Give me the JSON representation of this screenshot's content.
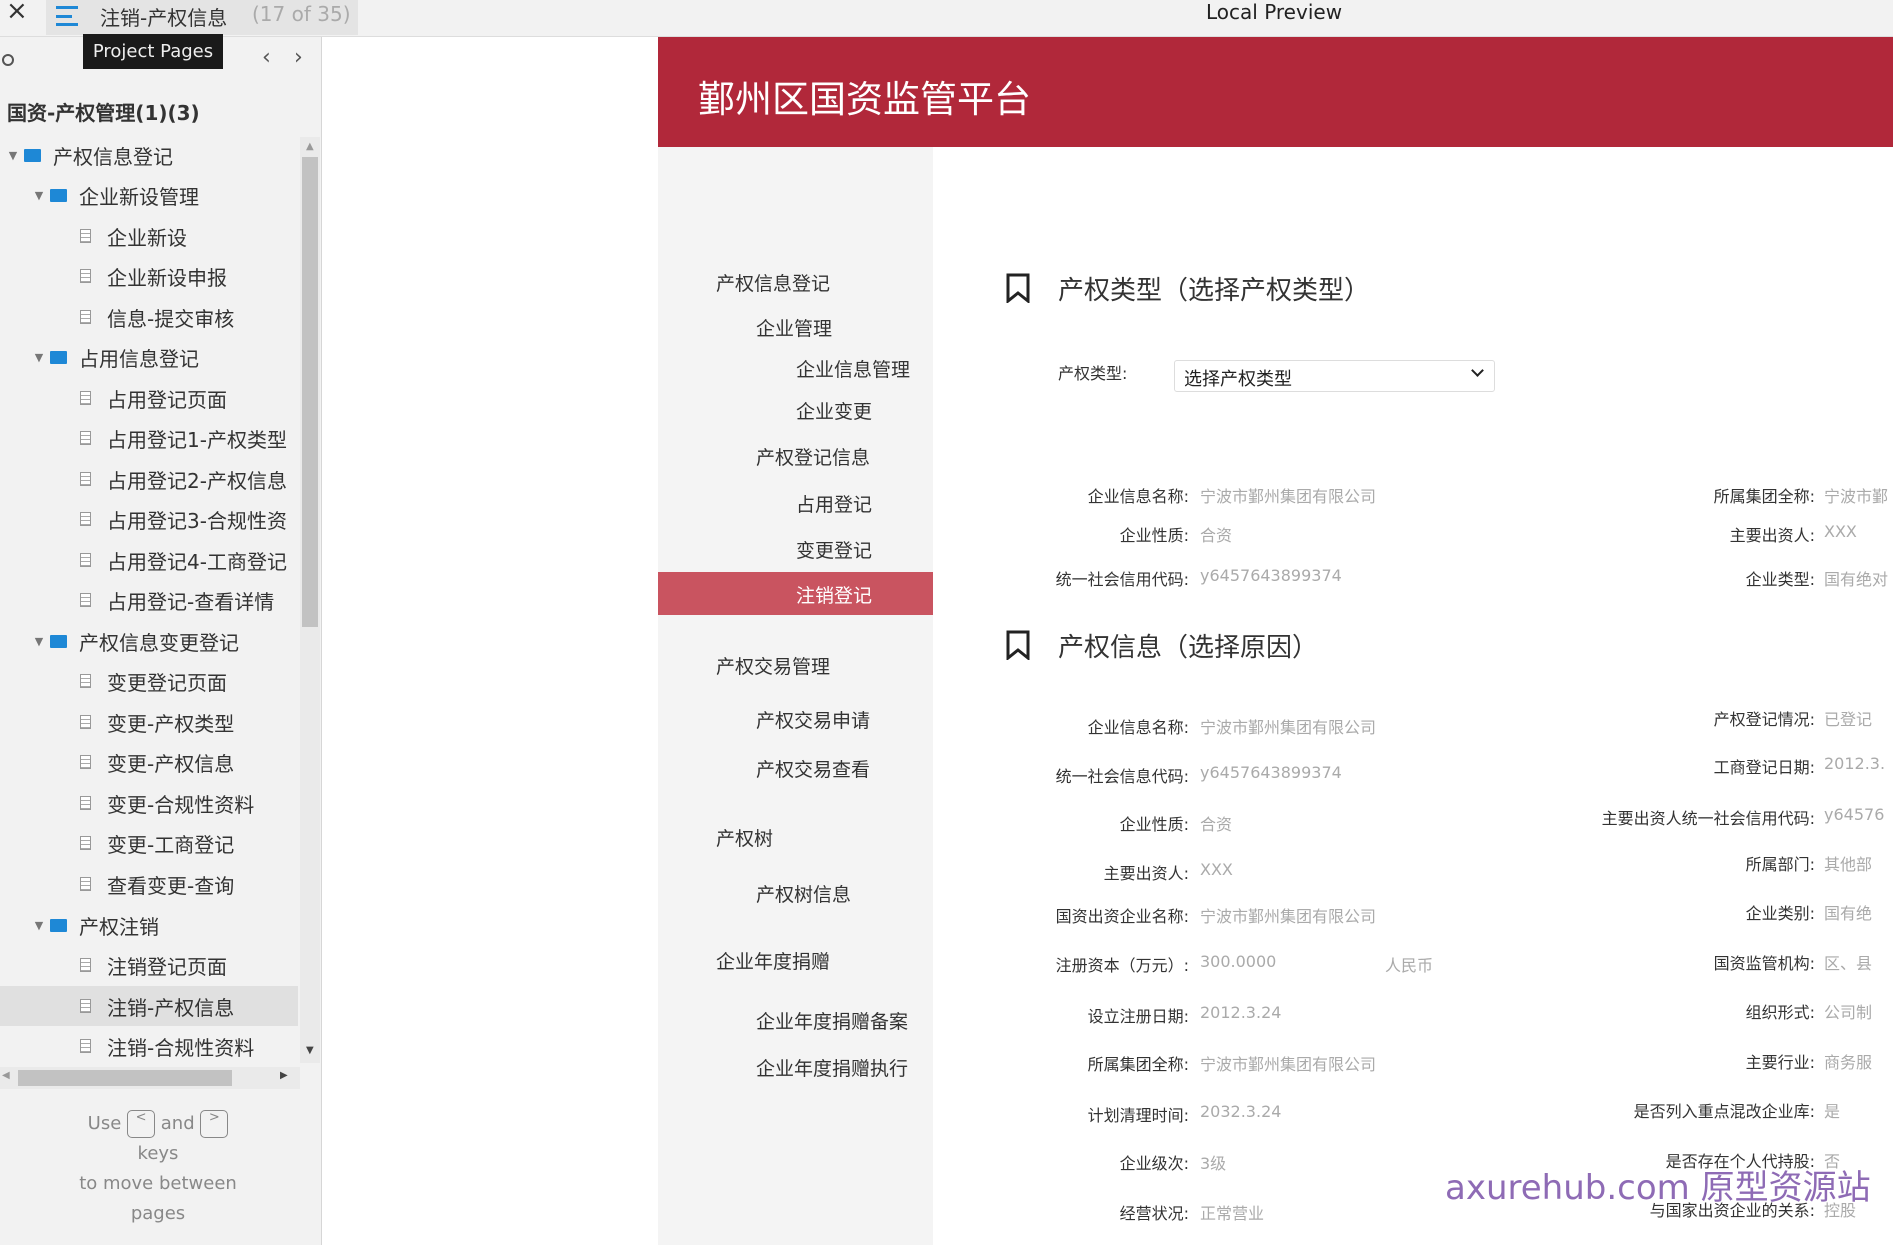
{
  "topbar": {
    "close": "×",
    "page_title": "注销-产权信息",
    "page_count": "(17 of 35)",
    "window_title": "Local Preview",
    "tooltip": "Project Pages"
  },
  "sidebar": {
    "project": "国资-产权管理(1)(3)",
    "tree": [
      {
        "level": 0,
        "type": "folder",
        "label": "产权信息登记"
      },
      {
        "level": 1,
        "type": "folder",
        "label": "企业新设管理"
      },
      {
        "level": 2,
        "type": "page",
        "label": "企业新设"
      },
      {
        "level": 2,
        "type": "page",
        "label": "企业新设申报"
      },
      {
        "level": 2,
        "type": "page",
        "label": "信息-提交审核"
      },
      {
        "level": 1,
        "type": "folder",
        "label": "占用信息登记"
      },
      {
        "level": 2,
        "type": "page",
        "label": "占用登记页面"
      },
      {
        "level": 2,
        "type": "page",
        "label": "占用登记1-产权类型"
      },
      {
        "level": 2,
        "type": "page",
        "label": "占用登记2-产权信息"
      },
      {
        "level": 2,
        "type": "page",
        "label": "占用登记3-合规性资"
      },
      {
        "level": 2,
        "type": "page",
        "label": "占用登记4-工商登记"
      },
      {
        "level": 2,
        "type": "page",
        "label": "占用登记-查看详情"
      },
      {
        "level": 1,
        "type": "folder",
        "label": "产权信息变更登记"
      },
      {
        "level": 2,
        "type": "page",
        "label": "变更登记页面"
      },
      {
        "level": 2,
        "type": "page",
        "label": "变更-产权类型"
      },
      {
        "level": 2,
        "type": "page",
        "label": "变更-产权信息"
      },
      {
        "level": 2,
        "type": "page",
        "label": "变更-合规性资料"
      },
      {
        "level": 2,
        "type": "page",
        "label": "变更-工商登记"
      },
      {
        "level": 2,
        "type": "page",
        "label": "查看变更-查询"
      },
      {
        "level": 1,
        "type": "folder",
        "label": "产权注销"
      },
      {
        "level": 2,
        "type": "page",
        "label": "注销登记页面"
      },
      {
        "level": 2,
        "type": "page",
        "label": "注销-产权信息",
        "selected": true
      },
      {
        "level": 2,
        "type": "page",
        "label": "注销-合规性资料"
      }
    ],
    "hint": {
      "use": "Use",
      "and": "and",
      "keys": "keys",
      "move": "to move between",
      "pages": "pages",
      "prev_key": "<",
      "next_key": ">"
    }
  },
  "app": {
    "title": "鄞州区国资监管平台",
    "brand_color": "#b1283a",
    "active_color": "#c95460"
  },
  "menu": [
    {
      "level": 0,
      "label": "产权信息登记"
    },
    {
      "level": 1,
      "label": "企业管理"
    },
    {
      "level": 2,
      "label": "企业信息管理"
    },
    {
      "level": 2,
      "label": "企业变更"
    },
    {
      "level": 1,
      "label": "产权登记信息"
    },
    {
      "level": 2,
      "label": "占用登记"
    },
    {
      "level": 2,
      "label": "变更登记"
    },
    {
      "level": 2,
      "label": "注销登记",
      "active": true
    },
    {
      "level": 0,
      "label": "产权交易管理"
    },
    {
      "level": 1,
      "label": "产权交易申请"
    },
    {
      "level": 1,
      "label": "产权交易查看"
    },
    {
      "level": 0,
      "label": "产权树"
    },
    {
      "level": 1,
      "label": "产权树信息"
    },
    {
      "level": 0,
      "label": "企业年度捐赠"
    },
    {
      "level": 1,
      "label": "企业年度捐赠备案"
    },
    {
      "level": 1,
      "label": "企业年度捐赠执行"
    }
  ],
  "section1": {
    "title": "产权类型（选择产权类型）",
    "select_label": "产权类型:",
    "select_value": "选择产权类型",
    "left": [
      {
        "label": "企业信息名称:",
        "value": "宁波市鄞州集团有限公司"
      },
      {
        "label": "企业性质:",
        "value": "合资"
      },
      {
        "label": "统一社会信用代码:",
        "value": "y6457643899374"
      }
    ],
    "right": [
      {
        "label": "所属集团全称:",
        "value": "宁波市鄞"
      },
      {
        "label": "主要出资人:",
        "value": "XXX"
      },
      {
        "label": "企业类型:",
        "value": "国有绝对"
      }
    ]
  },
  "section2": {
    "title": "产权信息（选择原因）",
    "currency": "人民币",
    "left": [
      {
        "label": "企业信息名称:",
        "value": "宁波市鄞州集团有限公司"
      },
      {
        "label": "统一社会信息代码:",
        "value": "y6457643899374"
      },
      {
        "label": "企业性质:",
        "value": "合资"
      },
      {
        "label": "主要出资人:",
        "value": "XXX"
      },
      {
        "label": "国资出资企业名称:",
        "value": "宁波市鄞州集团有限公司"
      },
      {
        "label": "注册资本（万元）:",
        "value": "300.0000"
      },
      {
        "label": "设立注册日期:",
        "value": "2012.3.24"
      },
      {
        "label": "所属集团全称:",
        "value": "宁波市鄞州集团有限公司"
      },
      {
        "label": "计划清理时间:",
        "value": "2032.3.24"
      },
      {
        "label": "企业级次:",
        "value": "3级"
      },
      {
        "label": "经营状况:",
        "value": "正常营业"
      }
    ],
    "right": [
      {
        "label": "产权登记情况:",
        "value": "已登记"
      },
      {
        "label": "工商登记日期:",
        "value": "2012.3."
      },
      {
        "label": "主要出资人统一社会信用代码:",
        "value": "y64576"
      },
      {
        "label": "所属部门:",
        "value": "其他部"
      },
      {
        "label": "企业类别:",
        "value": "国有绝"
      },
      {
        "label": "国资监管机构:",
        "value": "区、县"
      },
      {
        "label": "组织形式:",
        "value": "公司制"
      },
      {
        "label": "主要行业:",
        "value": "商务服"
      },
      {
        "label": "是否列入重点混改企业库:",
        "value": "是"
      },
      {
        "label": "是否存在个人代持股:",
        "value": "否"
      },
      {
        "label": "与国家出资企业的关系:",
        "value": "控股"
      }
    ]
  },
  "watermark": "axurehub.com 原型资源站"
}
